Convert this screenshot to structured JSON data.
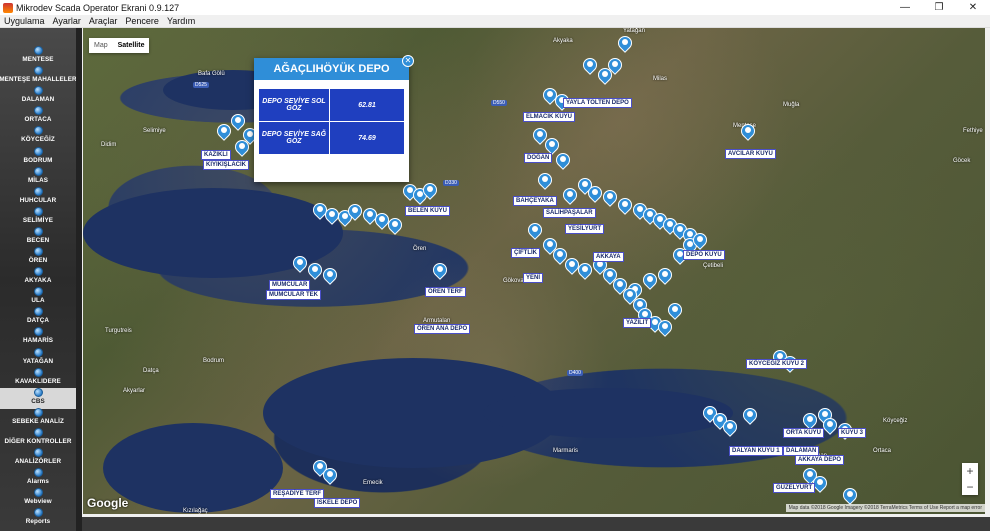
{
  "window": {
    "title": "Mikrodev Scada Operator Ekrani 0.9.127",
    "minimize": "—",
    "maximize": "❐",
    "close": "✕"
  },
  "menu": [
    "Uygulama",
    "Ayarlar",
    "Araçlar",
    "Pencere",
    "Yardım"
  ],
  "sidebar": {
    "items": [
      {
        "label": "MENTESE"
      },
      {
        "label": "MENTEŞE MAHALLELER"
      },
      {
        "label": "DALAMAN"
      },
      {
        "label": "ORTACA"
      },
      {
        "label": "KÖYCEĞİZ"
      },
      {
        "label": "BODRUM"
      },
      {
        "label": "MİLAS"
      },
      {
        "label": "HUHCULAR"
      },
      {
        "label": "SELİMİYE"
      },
      {
        "label": "BECEN"
      },
      {
        "label": "ÖREN"
      },
      {
        "label": "AKYAKA"
      },
      {
        "label": "ULA"
      },
      {
        "label": "DATÇA"
      },
      {
        "label": "HAMARİS"
      },
      {
        "label": "YATAĞAN"
      },
      {
        "label": "KAVAKLIDERE"
      },
      {
        "label": "CBS"
      },
      {
        "label": "SEBEKE ANALİZ"
      },
      {
        "label": "DİĞER KONTROLLER"
      },
      {
        "label": "ANALİZÖRLER"
      },
      {
        "label": "Alarms"
      },
      {
        "label": "Webview"
      },
      {
        "label": "Reports"
      }
    ],
    "active": "CBS"
  },
  "map": {
    "type_toggle": {
      "map": "Map",
      "satellite": "Satellite",
      "selected": "Satellite"
    },
    "popup": {
      "title": "AĞAÇLIHÖYÜK DEPO",
      "rows": [
        {
          "key": "DEPO SEVİYE SOL GÖZ",
          "value": "62.81"
        },
        {
          "key": "DEPO SEVİYE SAĞ GÖZ",
          "value": "74.69"
        }
      ]
    },
    "place_names": [
      "Bafa Gölü",
      "Selimiye",
      "Didim",
      "Akyaka",
      "Milas",
      "Ören",
      "Bodrum",
      "Datça",
      "Marmaris",
      "Dalaman",
      "Köyceğiz",
      "Ortaca",
      "Yatağan",
      "Muğla",
      "Çetibeli",
      "Armutalan",
      "Gökova",
      "Turgutreis",
      "Akyarlar",
      "Kızılağaç",
      "Emecik",
      "Göcek",
      "Fethiye",
      "Menteşe"
    ],
    "roads": [
      "D525",
      "D550",
      "D330",
      "D400"
    ],
    "tags": [
      "KAZIKLI",
      "KIYIKIŞLACIK",
      "ELMACIK KUYU",
      "YAYLA TOLTEN DEPO",
      "AVCILAR KUYU",
      "DOĞAN",
      "BAHÇEYAKA",
      "SALİHPAŞALAR",
      "ÇİFTLİK",
      "YENİ",
      "AKKAYA",
      "MUMCULAR",
      "MUMCULAR TEK",
      "ÖREN TERF",
      "ÖREN ANA DEPO",
      "YAZILIT",
      "KÖYCEĞİZ KUYU 2",
      "DALAMAN",
      "DALYAN KUYU 1",
      "AKKAYA DEPO",
      "GÜZELYURT",
      "REŞADİYE TERF",
      "İSKELE DEPO",
      "BELEN KUYU",
      "ORTA KUYU",
      "YESİLYURT",
      "DEPO KUYU",
      "KUYU 3"
    ],
    "zoom_in": "+",
    "zoom_out": "−",
    "google": "Google",
    "attribution": "Map data ©2018 Google Imagery ©2018 TerraMetrics   Terms of Use   Report a map error"
  }
}
